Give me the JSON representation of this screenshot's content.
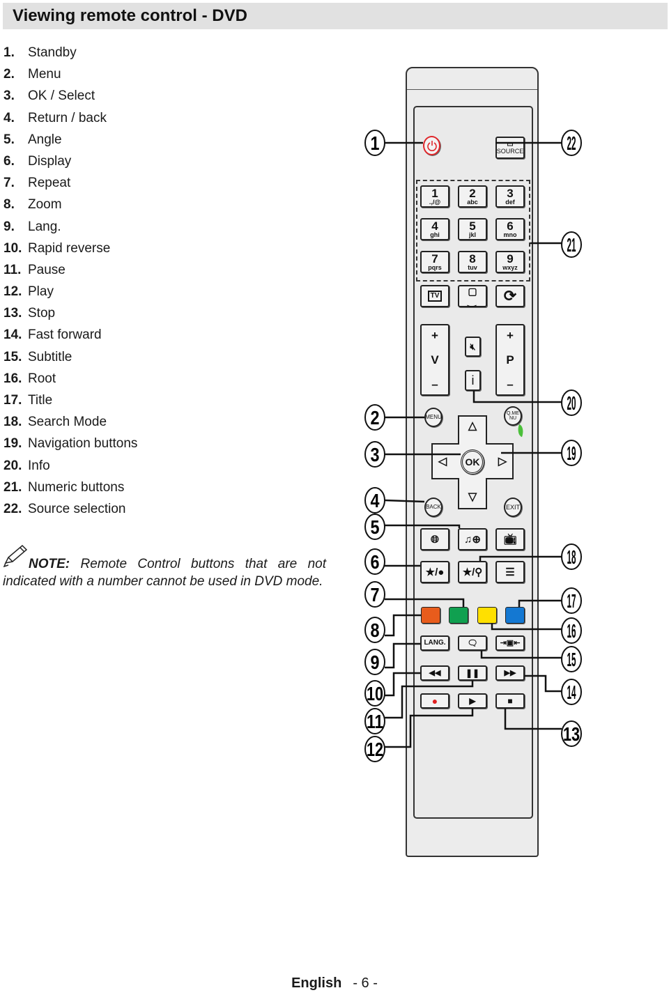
{
  "header": {
    "title": "Viewing remote control - DVD"
  },
  "items": [
    {
      "num": "1.",
      "label": "Standby"
    },
    {
      "num": "2.",
      "label": "Menu"
    },
    {
      "num": "3.",
      "label": "OK / Select"
    },
    {
      "num": "4.",
      "label": "Return / back"
    },
    {
      "num": "5.",
      "label": "Angle"
    },
    {
      "num": "6.",
      "label": "Display"
    },
    {
      "num": "7.",
      "label": "Repeat"
    },
    {
      "num": "8.",
      "label": "Zoom"
    },
    {
      "num": "9.",
      "label": "Lang."
    },
    {
      "num": "10.",
      "label": "Rapid reverse"
    },
    {
      "num": "11.",
      "label": "Pause"
    },
    {
      "num": "12.",
      "label": "Play"
    },
    {
      "num": "13.",
      "label": "Stop"
    },
    {
      "num": "14.",
      "label": "Fast forward"
    },
    {
      "num": "15.",
      "label": "Subtitle"
    },
    {
      "num": "16.",
      "label": "Root"
    },
    {
      "num": "17.",
      "label": "Title"
    },
    {
      "num": "18.",
      "label": "Search Mode"
    },
    {
      "num": "19.",
      "label": "Navigation buttons"
    },
    {
      "num": "20.",
      "label": "Info"
    },
    {
      "num": "21.",
      "label": "Numeric buttons"
    },
    {
      "num": "22.",
      "label": "Source selection"
    }
  ],
  "note": {
    "prefix": "NOTE:",
    "line1": "Remote Control buttons that are not",
    "line2": "indicated with a number cannot be used in DVD mode.",
    "icon": "pencil-icon"
  },
  "footer": {
    "language": "English",
    "page": "- 6 -"
  },
  "remote": {
    "source": "SOURCE",
    "keys": [
      {
        "d": "1",
        "s": ".,/@"
      },
      {
        "d": "2",
        "s": "abc"
      },
      {
        "d": "3",
        "s": "def"
      },
      {
        "d": "4",
        "s": "ghi"
      },
      {
        "d": "5",
        "s": "jkl"
      },
      {
        "d": "6",
        "s": "mno"
      },
      {
        "d": "7",
        "s": "pqrs"
      },
      {
        "d": "8",
        "s": "tuv"
      },
      {
        "d": "9",
        "s": "wxyz"
      }
    ],
    "tv": "TV",
    "vol": "V",
    "prog": "P",
    "plus": "+",
    "minus": "–",
    "info": "i",
    "menu": "MENU",
    "qmenu": "Q.MENU",
    "ok": "OK",
    "back": "BACK",
    "exit": "EXIT",
    "lang": "LANG.",
    "colors": {
      "red": "#e85c1c",
      "green": "#10a050",
      "yellow": "#ffe000",
      "blue": "#1478d2",
      "standby": "#e0262a",
      "record": "#e02020",
      "leaf": "#4bbf3a"
    },
    "callouts_left": [
      "1",
      "2",
      "3",
      "4",
      "5",
      "6",
      "7",
      "8",
      "9",
      "10",
      "11",
      "12"
    ],
    "callouts_right": [
      "22",
      "21",
      "20",
      "19",
      "18",
      "17",
      "16",
      "15",
      "14",
      "13"
    ]
  }
}
